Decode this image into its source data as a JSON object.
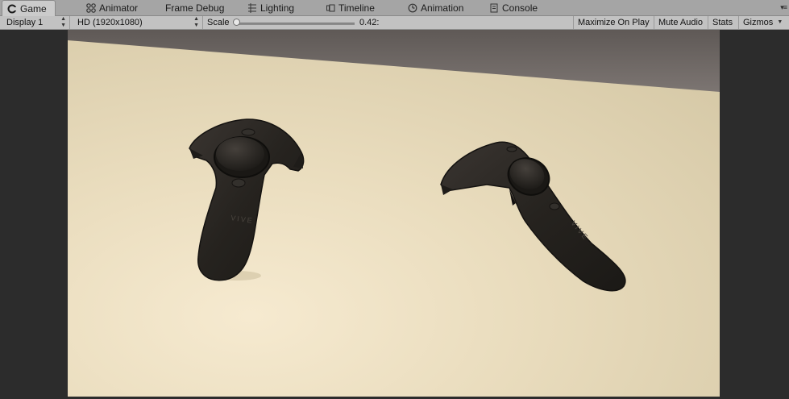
{
  "tabs": [
    {
      "label": "Game",
      "icon": "game-icon",
      "active": true
    },
    {
      "label": "Animator",
      "icon": "animator-icon",
      "active": false
    },
    {
      "label": "Frame Debug",
      "icon": "",
      "active": false
    },
    {
      "label": "Lighting",
      "icon": "lighting-icon",
      "active": false
    },
    {
      "label": "Timeline",
      "icon": "timeline-icon",
      "active": false
    },
    {
      "label": "Animation",
      "icon": "animation-icon",
      "active": false
    },
    {
      "label": "Console",
      "icon": "console-icon",
      "active": false
    }
  ],
  "toolbar": {
    "display": "Display 1",
    "resolution": "HD (1920x1080)",
    "scale_label": "Scale",
    "scale_value": "0.42:",
    "scale_fraction": 0.0,
    "maximize_on_play": "Maximize On Play",
    "mute_audio": "Mute Audio",
    "stats": "Stats",
    "gizmos": "Gizmos"
  },
  "scene": {
    "controller_brand_left": "VIVE",
    "controller_brand_right": "VIVE"
  },
  "colors": {
    "tabbar_bg": "#a5a5a5",
    "toolbar_bg": "#c2c2c2",
    "wall_light": "#f3e8cf",
    "ceiling": "#6e6866",
    "controller": "#2a2724"
  }
}
